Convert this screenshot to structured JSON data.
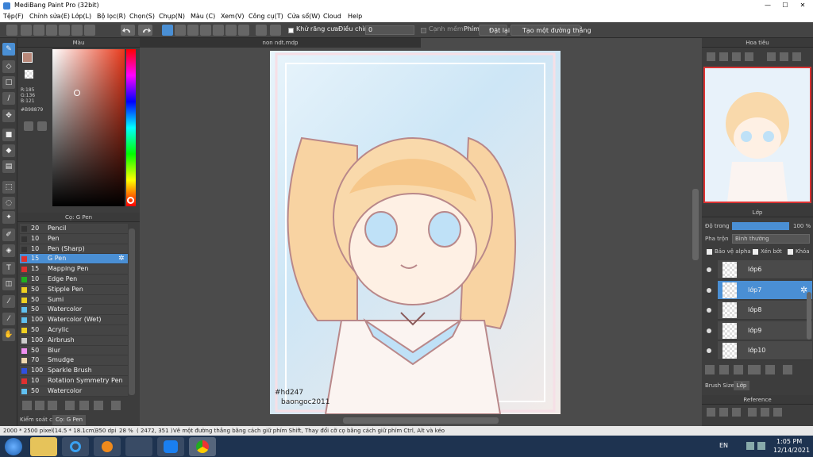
{
  "app": {
    "title": "MediBang Paint Pro (32bit)",
    "minimize": "—",
    "maximize": "☐",
    "close": "✕"
  },
  "menu": [
    "Tệp(F)",
    "Chỉnh sửa(E)",
    "Lớp(L)",
    "Bộ lọc(R)",
    "Chọn(S)",
    "Chụp(N)",
    "Màu (C)",
    "Xem(V)",
    "Công cụ(T)",
    "Cửa sổ(W)",
    "Cloud",
    "Help"
  ],
  "toolbar": {
    "antialias": "Khử răng cưa",
    "adjust": "Điều chỉnh",
    "adjust_value": "0",
    "edge": "Cạnh mềm",
    "key": "Phím",
    "reset": "Đặt lại",
    "create_line": "Tạo một đường thẳng"
  },
  "color_panel": {
    "title": "Màu",
    "r": "R:185",
    "g": "G:136",
    "b": "B:121",
    "hex": "#B98879"
  },
  "brush_panel": {
    "title": "Cọ: G Pen",
    "items": [
      {
        "size": "20",
        "name": "Pencil",
        "color": "#333333",
        "selected": false
      },
      {
        "size": "10",
        "name": "Pen",
        "color": "#333333",
        "selected": false
      },
      {
        "size": "10",
        "name": "Pen (Sharp)",
        "color": "#333333",
        "selected": false
      },
      {
        "size": "15",
        "name": "G Pen",
        "color": "#e03030",
        "selected": true
      },
      {
        "size": "15",
        "name": "Mapping Pen",
        "color": "#e03030",
        "selected": false
      },
      {
        "size": "10",
        "name": "Edge Pen",
        "color": "#20b020",
        "selected": false
      },
      {
        "size": "50",
        "name": "Stipple Pen",
        "color": "#f0d020",
        "selected": false
      },
      {
        "size": "50",
        "name": "Sumi",
        "color": "#f0d020",
        "selected": false
      },
      {
        "size": "50",
        "name": "Watercolor",
        "color": "#60c0f0",
        "selected": false
      },
      {
        "size": "100",
        "name": "Watercolor (Wet)",
        "color": "#60c0f0",
        "selected": false
      },
      {
        "size": "50",
        "name": "Acrylic",
        "color": "#f0d020",
        "selected": false
      },
      {
        "size": "100",
        "name": "Airbrush",
        "color": "#cccccc",
        "selected": false
      },
      {
        "size": "50",
        "name": "Blur",
        "color": "#f090f0",
        "selected": false
      },
      {
        "size": "70",
        "name": "Smudge",
        "color": "#f0d8b0",
        "selected": false
      },
      {
        "size": "100",
        "name": "Sparkle Brush",
        "color": "#3050e0",
        "selected": false
      },
      {
        "size": "10",
        "name": "Rotation Symmetry Pen",
        "color": "#e03030",
        "selected": false
      },
      {
        "size": "50",
        "name": "Watercolor",
        "color": "#60c0f0",
        "selected": false
      }
    ],
    "tab_control": "Kiểm soát cọ",
    "tab_brush": "Cọ: G Pen"
  },
  "document": {
    "tab": "non ndt.mdp",
    "caption_1": "#hd247",
    "caption_2": "baongoc2011"
  },
  "navigator": {
    "title": "Hoa tiêu"
  },
  "layers": {
    "title": "Lớp",
    "opacity_label": "Độ trong",
    "opacity_value": "100 %",
    "blend_label": "Pha trộn",
    "blend_value": "Bình thường",
    "protect_alpha": "Bảo vệ alpha",
    "clipping": "Xén bớt",
    "lock": "Khóa",
    "items": [
      {
        "name": "lớp6",
        "selected": false
      },
      {
        "name": "lớp7",
        "selected": true
      },
      {
        "name": "lớp8",
        "selected": false
      },
      {
        "name": "lớp9",
        "selected": false
      },
      {
        "name": "lớp10",
        "selected": false
      }
    ],
    "tab_brush_size": "Brush Size",
    "tab_layer": "Lớp"
  },
  "reference": {
    "title": "Reference"
  },
  "status": {
    "size": "2000 * 2500 pixel",
    "cm": "(14.5 * 18.1cm)",
    "dpi": "350 dpi",
    "zoom": "28 %",
    "coords": "( 2472, 351 )",
    "hint": "Vẽ một đường thẳng bằng cách giữ phím Shift, Thay đổi cỡ cọ bằng cách giữ phím Ctrl, Alt và kéo"
  },
  "taskbar": {
    "lang": "EN",
    "time": "1:05 PM",
    "date": "12/14/2021"
  }
}
